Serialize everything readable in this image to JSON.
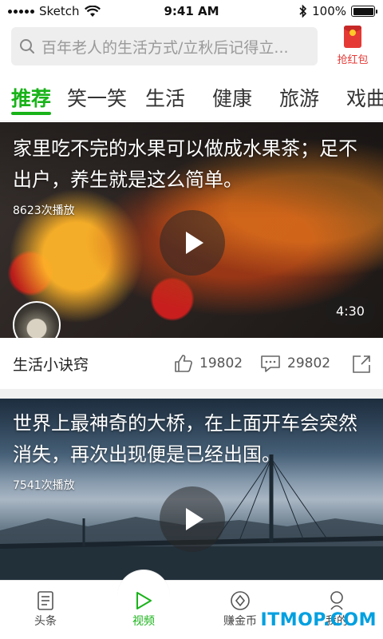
{
  "status_bar": {
    "carrier": "Sketch",
    "time": "9:41 AM",
    "battery": "100%"
  },
  "search": {
    "placeholder": "百年老人的生活方式/立秋后记得立..."
  },
  "redpacket": {
    "label": "抢红包"
  },
  "tabs": [
    {
      "label": "推荐",
      "active": true
    },
    {
      "label": "笑一笑"
    },
    {
      "label": "生活"
    },
    {
      "label": "健康"
    },
    {
      "label": "旅游"
    },
    {
      "label": "戏曲"
    }
  ],
  "cards": [
    {
      "title": "家里吃不完的水果可以做成水果茶；足不出户，养生就是这么简单。",
      "plays": "8623次播放",
      "duration": "4:30",
      "author": "生活小诀窍",
      "likes": "19802",
      "comments": "29802"
    },
    {
      "title": "世界上最神奇的大桥，在上面开车会突然消失，再次出现便是已经出国。",
      "plays": "7541次播放"
    }
  ],
  "bottom_nav": [
    {
      "label": "头条",
      "icon": "news-icon"
    },
    {
      "label": "视频",
      "icon": "play-icon",
      "active": true
    },
    {
      "label": "赚金币",
      "icon": "coin-icon"
    },
    {
      "label": "我的",
      "icon": "user-icon"
    }
  ],
  "watermark": "ITMOP.COM",
  "colors": {
    "accent": "#19b319",
    "redpacket": "#e53935"
  }
}
